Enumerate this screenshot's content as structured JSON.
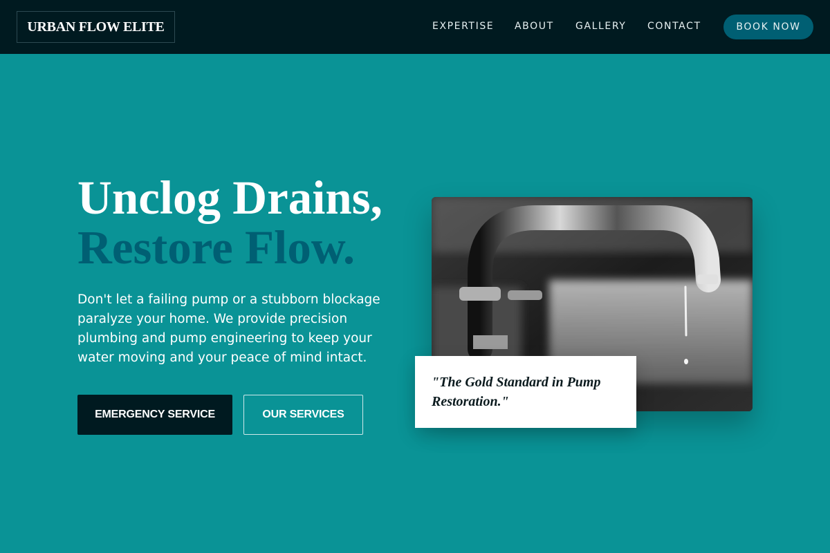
{
  "header": {
    "logo": "URBAN FLOW ELITE",
    "nav": [
      "EXPERTISE",
      "ABOUT",
      "GALLERY",
      "CONTACT"
    ],
    "cta": "BOOK NOW"
  },
  "hero": {
    "headline_line1": "Unclog Drains,",
    "headline_line2": "Restore Flow.",
    "lead": "Don't let a failing pump or a stubborn blockage paralyze your home. We provide precision plumbing and pump engineering to keep your water moving and your peace of mind intact.",
    "primary_button": "EMERGENCY SERVICE",
    "secondary_button": "OUR SERVICES",
    "quote": "\"The Gold Standard in Pump Restoration.\"",
    "image_alt": "faucet-dripping-photo"
  },
  "colors": {
    "background": "#0a9396",
    "header": "#001a20",
    "accent": "#005f73",
    "text_light": "#ffffff"
  }
}
